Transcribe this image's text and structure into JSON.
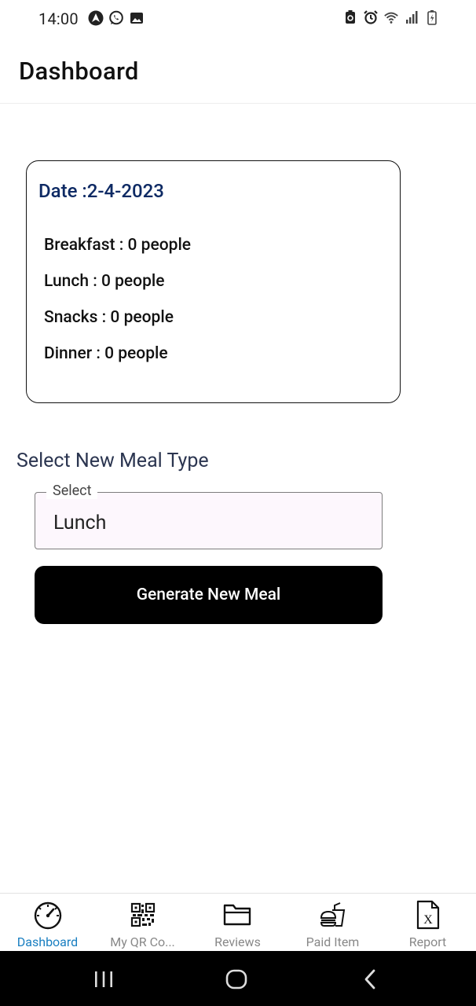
{
  "status_bar": {
    "time": "14:00",
    "left_icons": [
      "nav-app-icon",
      "whatsapp-icon",
      "image-icon"
    ],
    "right_icons": [
      "battery-saver-icon",
      "alarm-icon",
      "wifi-icon",
      "signal-icon",
      "battery-charging-icon"
    ]
  },
  "header": {
    "title": "Dashboard"
  },
  "summary_card": {
    "date": "Date :2-4-2023",
    "meals": [
      {
        "label": "Breakfast : 0 people"
      },
      {
        "label": "Lunch : 0 people"
      },
      {
        "label": "Snacks : 0 people"
      },
      {
        "label": "Dinner : 0 people"
      }
    ]
  },
  "meal_select": {
    "section_label": "Select New Meal Type",
    "field_label": "Select",
    "value": "Lunch"
  },
  "generate_button": {
    "label": "Generate New Meal"
  },
  "bottom_nav": {
    "items": [
      {
        "label": "Dashboard",
        "icon": "speedometer-icon",
        "active": true
      },
      {
        "label": "My QR Co...",
        "icon": "qr-code-icon",
        "active": false
      },
      {
        "label": "Reviews",
        "icon": "folder-icon",
        "active": false
      },
      {
        "label": "Paid Item",
        "icon": "fast-food-icon",
        "active": false
      },
      {
        "label": "Report",
        "icon": "excel-file-icon",
        "active": false
      }
    ]
  },
  "colors": {
    "accent": "#1a7fc1",
    "date_text": "#0e2a64",
    "button_bg": "#000000",
    "select_bg": "#fdf7fd"
  }
}
